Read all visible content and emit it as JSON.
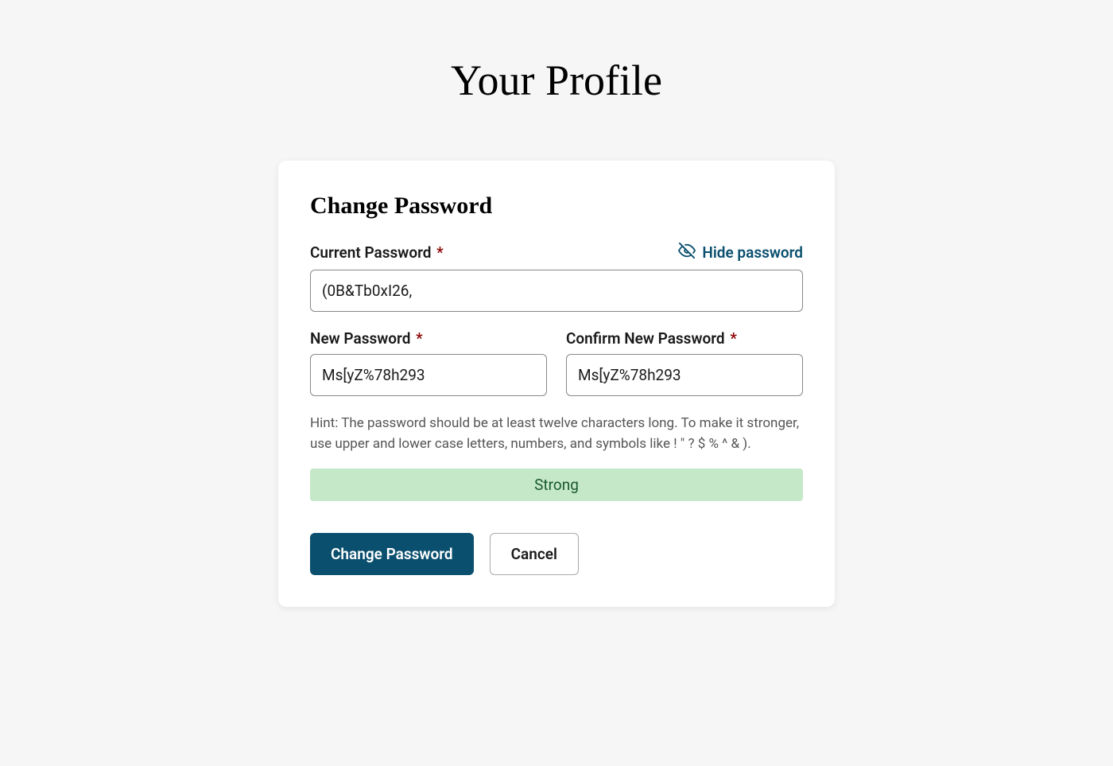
{
  "page": {
    "title": "Your Profile"
  },
  "card": {
    "title": "Change Password",
    "hide_password_label": "Hide password",
    "fields": {
      "current_password": {
        "label": "Current Password",
        "value": "(0B&Tb0xI26,"
      },
      "new_password": {
        "label": "New Password",
        "value": "Ms[yZ%78h293"
      },
      "confirm_password": {
        "label": "Confirm New Password",
        "value": "Ms[yZ%78h293"
      }
    },
    "hint": "Hint: The password should be at least twelve characters long. To make it stronger, use upper and lower case letters, numbers, and symbols like ! \" ? $ % ^ & ).",
    "strength": "Strong",
    "buttons": {
      "submit": "Change Password",
      "cancel": "Cancel"
    }
  }
}
